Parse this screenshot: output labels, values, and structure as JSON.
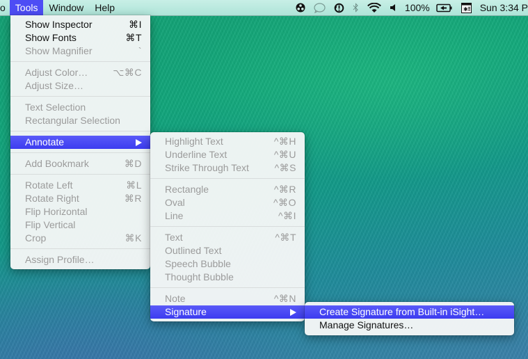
{
  "menubar": {
    "partial_item": "o",
    "items": [
      {
        "label": "Tools",
        "active": true
      },
      {
        "label": "Window",
        "active": false
      },
      {
        "label": "Help",
        "active": false
      }
    ],
    "status": {
      "icons": [
        "accessibility-icon",
        "messages-icon",
        "time-machine-icon",
        "bluetooth-icon",
        "wifi-icon",
        "volume-icon"
      ],
      "battery_percent": "100%",
      "clock": "Sun 3:34 P"
    }
  },
  "tools_menu": {
    "groups": [
      [
        {
          "label": "Show Inspector",
          "shortcut": "⌘I",
          "enabled": true
        },
        {
          "label": "Show Fonts",
          "shortcut": "⌘T",
          "enabled": true
        },
        {
          "label": "Show Magnifier",
          "shortcut": "`",
          "enabled": false
        }
      ],
      [
        {
          "label": "Adjust Color…",
          "shortcut": "⌥⌘C",
          "enabled": false
        },
        {
          "label": "Adjust Size…",
          "shortcut": "",
          "enabled": false
        }
      ],
      [
        {
          "label": "Text Selection",
          "shortcut": "",
          "enabled": false
        },
        {
          "label": "Rectangular Selection",
          "shortcut": "",
          "enabled": false
        }
      ],
      [
        {
          "label": "Annotate",
          "shortcut": "",
          "enabled": true,
          "submenu": true,
          "highlighted": true
        }
      ],
      [
        {
          "label": "Add Bookmark",
          "shortcut": "⌘D",
          "enabled": false
        }
      ],
      [
        {
          "label": "Rotate Left",
          "shortcut": "⌘L",
          "enabled": false
        },
        {
          "label": "Rotate Right",
          "shortcut": "⌘R",
          "enabled": false
        },
        {
          "label": "Flip Horizontal",
          "shortcut": "",
          "enabled": false
        },
        {
          "label": "Flip Vertical",
          "shortcut": "",
          "enabled": false
        },
        {
          "label": "Crop",
          "shortcut": "⌘K",
          "enabled": false
        }
      ],
      [
        {
          "label": "Assign Profile…",
          "shortcut": "",
          "enabled": false
        }
      ]
    ]
  },
  "annotate_menu": {
    "groups": [
      [
        {
          "label": "Highlight Text",
          "shortcut": "^⌘H",
          "enabled": false
        },
        {
          "label": "Underline Text",
          "shortcut": "^⌘U",
          "enabled": false
        },
        {
          "label": "Strike Through Text",
          "shortcut": "^⌘S",
          "enabled": false
        }
      ],
      [
        {
          "label": "Rectangle",
          "shortcut": "^⌘R",
          "enabled": false
        },
        {
          "label": "Oval",
          "shortcut": "^⌘O",
          "enabled": false
        },
        {
          "label": "Line",
          "shortcut": "^⌘I",
          "enabled": false
        }
      ],
      [
        {
          "label": "Text",
          "shortcut": "^⌘T",
          "enabled": false
        },
        {
          "label": "Outlined Text",
          "shortcut": "",
          "enabled": false
        },
        {
          "label": "Speech Bubble",
          "shortcut": "",
          "enabled": false
        },
        {
          "label": "Thought Bubble",
          "shortcut": "",
          "enabled": false
        }
      ],
      [
        {
          "label": "Note",
          "shortcut": "^⌘N",
          "enabled": false
        },
        {
          "label": "Signature",
          "shortcut": "",
          "enabled": true,
          "submenu": true,
          "highlighted": true
        }
      ]
    ]
  },
  "signature_menu": {
    "groups": [
      [
        {
          "label": "Create Signature from Built-in iSight…",
          "shortcut": "",
          "enabled": true,
          "highlighted": true
        },
        {
          "label": "Manage Signatures…",
          "shortcut": "",
          "enabled": true
        }
      ]
    ]
  },
  "colors": {
    "highlight": "#4d4df5",
    "menubar_bg": "#bfeae0",
    "menu_bg": "#f4f6f6",
    "disabled_text": "#9b9b9b"
  }
}
